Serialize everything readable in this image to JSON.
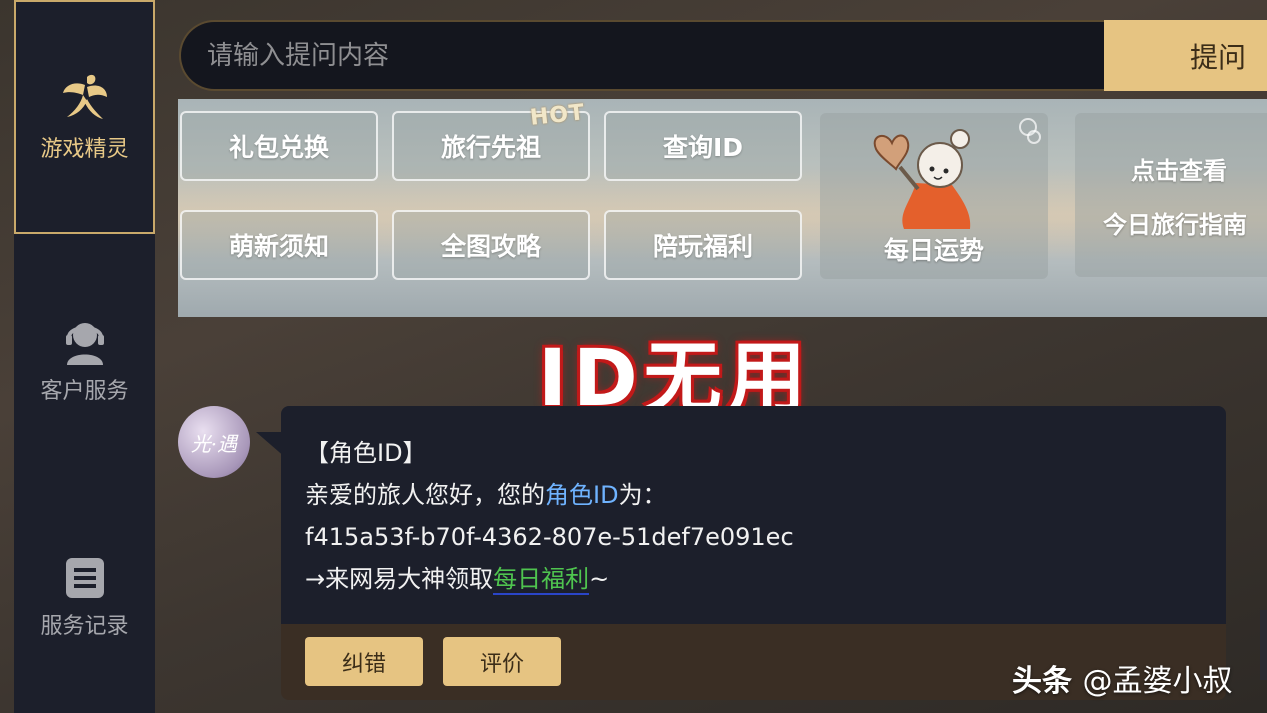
{
  "sidebar": {
    "items": [
      {
        "label": "游戏精灵",
        "icon": "fairy-icon",
        "active": true
      },
      {
        "label": "客户服务",
        "icon": "headset-agent-icon",
        "active": false
      },
      {
        "label": "服务记录",
        "icon": "list-record-icon",
        "active": false
      }
    ]
  },
  "search": {
    "placeholder": "请输入提问内容",
    "submit_label": "提问"
  },
  "banner": {
    "quick_buttons": [
      "礼包兑换",
      "旅行先祖",
      "查询ID",
      "萌新须知",
      "全图攻略",
      "陪玩福利"
    ],
    "hot_badge": "HOT",
    "fortune_label": "每日运势",
    "guide_line1": "点击查看",
    "guide_line2": "今日旅行指南"
  },
  "caption": "ID无用",
  "avatar_text": "光·遇",
  "message": {
    "title": "【角色ID】",
    "greeting_prefix": "亲爱的旅人您好，您的",
    "greeting_link": "角色ID",
    "greeting_suffix": "为：",
    "role_id": "f415a53f-b70f-4362-807e-51def7e091ec",
    "cta_prefix": "→来网易大神领取",
    "cta_link": "每日福利",
    "cta_suffix": "~"
  },
  "footer_buttons": {
    "correct_label": "纠错",
    "rate_label": "评价"
  },
  "watermark": {
    "brand": "头条",
    "handle": "@孟婆小叔"
  },
  "colors": {
    "accent_gold": "#e6c482",
    "panel_dark": "#1c1f2b",
    "link_blue": "#6fb3ff",
    "link_green": "#4fc44f",
    "caption_red": "#c21a1a"
  }
}
